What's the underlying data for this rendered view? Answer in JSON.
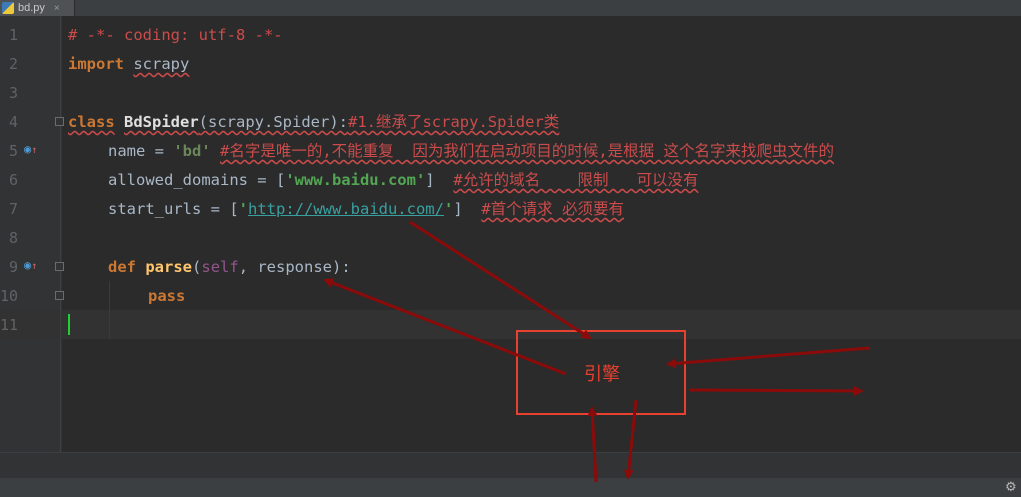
{
  "tab": {
    "filename": "bd.py",
    "close_glyph": "×"
  },
  "line_numbers": [
    "1",
    "2",
    "3",
    "4",
    "5",
    "6",
    "7",
    "8",
    "9",
    "10",
    "11"
  ],
  "code": {
    "l1": "# -*- coding: utf-8 -*-",
    "l2_kw": "import",
    "l2_mod": "scrapy",
    "l4_kw": "class",
    "l4_name": "BdSpider",
    "l4_args": "(scrapy.Spider):",
    "l4_comment": "#1.继承了scrapy.Spider类",
    "l5_var": "name = ",
    "l5_str": "'bd'",
    "l5_comment": "#名字是唯一的,不能重复  因为我们在启动项目的时候,是根据 这个名字来找爬虫文件的",
    "l6_var": "allowed_domains = [",
    "l6_str": "'www.baidu.com'",
    "l6_end": "]",
    "l6_comment": "#允许的域名    限制   可以没有",
    "l7_var": "start_urls = [",
    "l7_q1": "'",
    "l7_url": "http://www.baidu.com/",
    "l7_q2": "'",
    "l7_end": "]",
    "l7_comment": "#首个请求 必须要有",
    "l9_kw": "def",
    "l9_name": "parse",
    "l9_open": "(",
    "l9_self": "self",
    "l9_rest": ", response):",
    "l10_kw": "pass"
  },
  "annotation": {
    "engine_label": "引擎",
    "box_color": "#e8412f",
    "arrow_color": "#8b0a0a"
  },
  "icons": [
    "python-file-icon",
    "close-icon",
    "override-marker-icon",
    "fold-icon",
    "settings-gear-icon"
  ]
}
